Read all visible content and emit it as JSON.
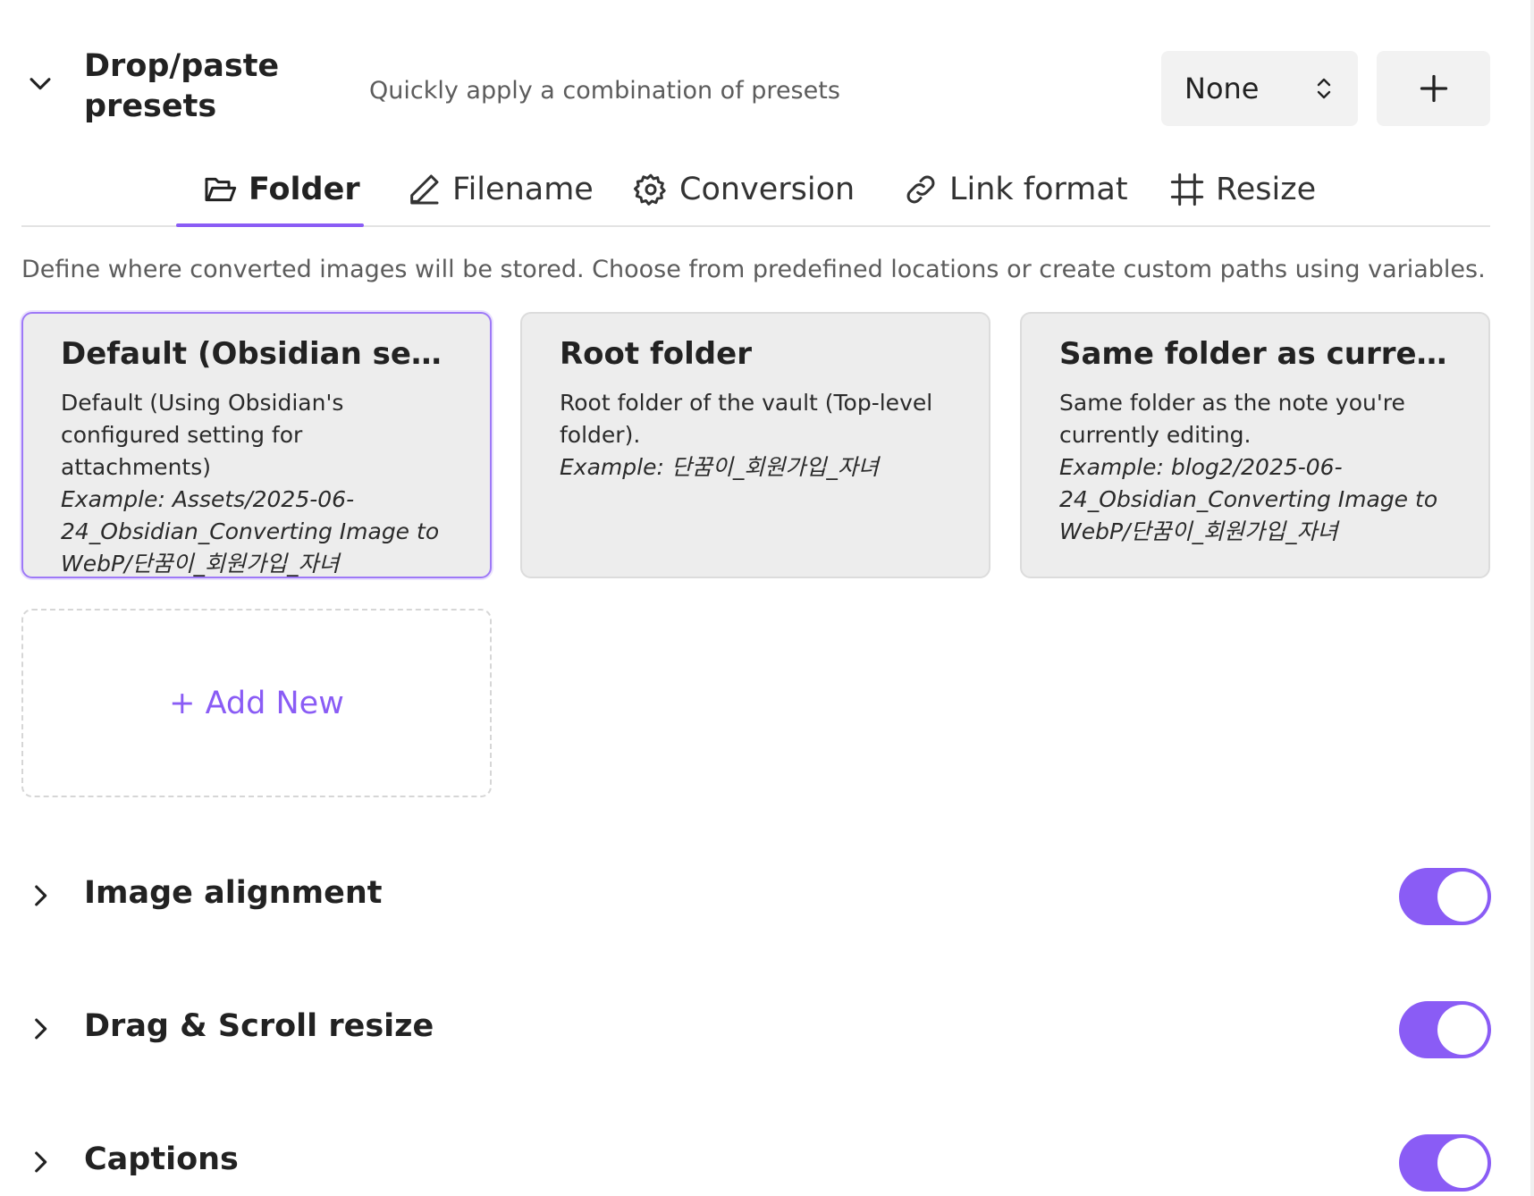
{
  "header": {
    "title": "Drop/paste presets",
    "description": "Quickly apply a combination of presets",
    "preset_select": {
      "value": "None"
    },
    "add_label": "+"
  },
  "tabs": [
    {
      "label": "Folder",
      "icon": "folder-open-icon",
      "active": true
    },
    {
      "label": "Filename",
      "icon": "pencil-icon",
      "active": false
    },
    {
      "label": "Conversion",
      "icon": "gear-icon",
      "active": false
    },
    {
      "label": "Link format",
      "icon": "link-icon",
      "active": false
    },
    {
      "label": "Resize",
      "icon": "crop-icon",
      "active": false
    }
  ],
  "folder": {
    "description": "Define where converted images will be stored. Choose from predefined locations or create custom paths using variables.",
    "cards": [
      {
        "title": "Default (Obsidian setting)",
        "body": "Default (Using Obsidian's configured setting for attachments)",
        "example": "Example: Assets/2025-06-24_Obsidian_Converting Image to WebP/단꿈이_회원가입_자녀",
        "selected": true
      },
      {
        "title": "Root folder",
        "body": "Root folder of the vault (Top-level folder).",
        "example": "Example: 단꿈이_회원가입_자녀",
        "selected": false
      },
      {
        "title": "Same folder as current ...",
        "body": "Same folder as the note you're currently editing.",
        "example": "Example: blog2/2025-06-24_Obsidian_Converting Image to WebP/단꿈이_회원가입_자녀",
        "selected": false
      }
    ],
    "add_new_label": "+ Add New"
  },
  "sections": [
    {
      "title": "Image alignment",
      "enabled": true
    },
    {
      "title": "Drag & Scroll resize",
      "enabled": true
    },
    {
      "title": "Captions",
      "enabled": true
    }
  ],
  "colors": {
    "accent": "#8a5cf5",
    "card_bg": "#ededed",
    "muted_text": "#5c5c5c"
  }
}
